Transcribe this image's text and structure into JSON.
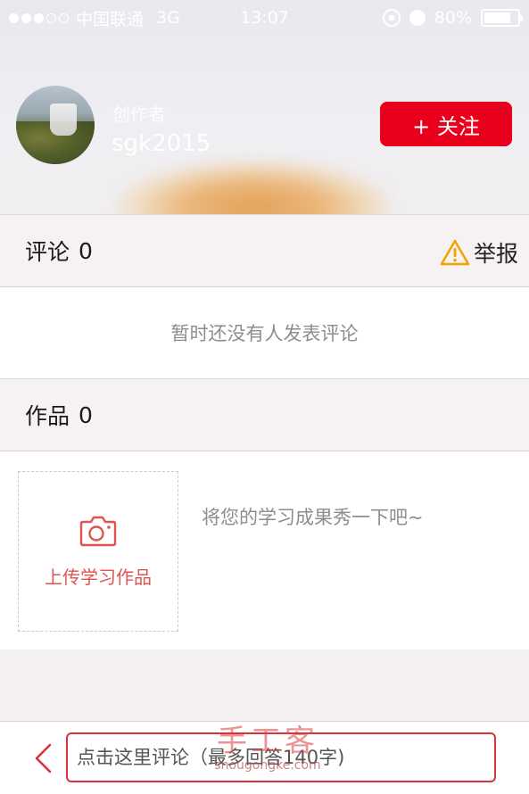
{
  "status_bar": {
    "carrier": "中国联通",
    "network": "3G",
    "time": "13:07",
    "battery": "80%",
    "battery_level": 0.8,
    "signal_bars_filled": 3,
    "signal_bars_total": 5
  },
  "creator": {
    "role": "创作者",
    "name": "sgk2015",
    "follow_label": "+ 关注"
  },
  "comments": {
    "title": "评论",
    "count": "0",
    "report_label": "举报",
    "empty_text": "暂时还没有人发表评论"
  },
  "works": {
    "title": "作品",
    "count": "0",
    "upload_label": "上传学习作品",
    "hint": "将您的学习成果秀一下吧~"
  },
  "comment_bar": {
    "placeholder": "点击这里评论（最多回答140字)"
  },
  "watermark": {
    "main": "手工客",
    "url": "shougongke.com"
  },
  "colors": {
    "accent_red": "#e8001c",
    "input_border": "#d9323a",
    "upload_text": "#e0534f",
    "warning": "#f0a400"
  },
  "icons": [
    "back-chevron-icon",
    "warning-triangle-icon",
    "camera-icon",
    "rotation-lock-icon",
    "alarm-icon",
    "battery-icon"
  ]
}
